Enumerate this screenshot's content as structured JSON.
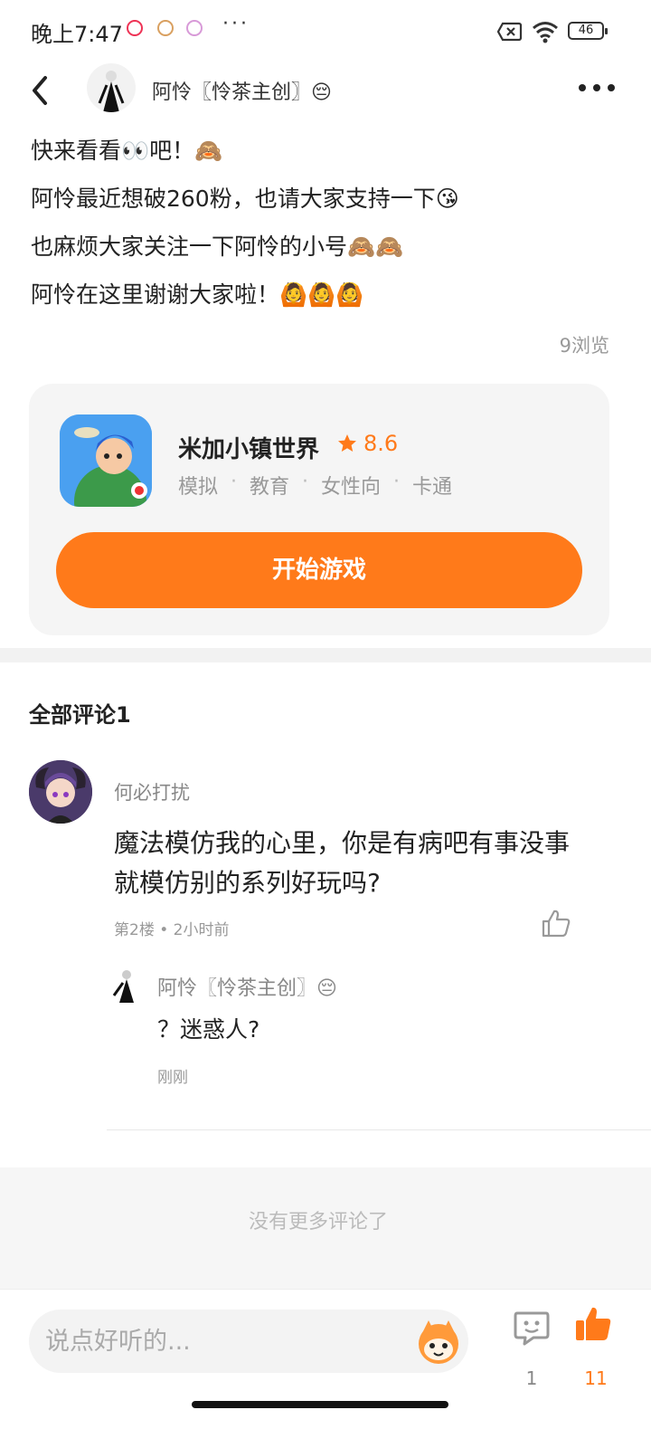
{
  "status": {
    "time": "晚上7:47",
    "more": "···",
    "battery": "46"
  },
  "header": {
    "author_name": "阿怜〖怜茶主创〗😔"
  },
  "post": {
    "lines": [
      "快来看看👀吧！🙈",
      "阿怜最近想破260粉，也请大家支持一下😘",
      "也麻烦大家关注一下阿怜的小号🙈🙈",
      "阿怜在这里谢谢大家啦！🙆🙆🙆"
    ],
    "views": "9浏览"
  },
  "game": {
    "title": "米加小镇世界",
    "rating": "8.6",
    "tags": [
      "模拟",
      "教育",
      "女性向",
      "卡通"
    ],
    "tag_separator": "·",
    "play_label": "开始游戏"
  },
  "comments": {
    "title": "全部评论1",
    "items": [
      {
        "user": "何必打扰",
        "text": "魔法模仿我的心里，你是有病吧有事没事就模仿别的系列好玩吗?",
        "meta": "第2楼 • 2小时前",
        "reply": {
          "user": "阿怜〖怜茶主创〗😔",
          "text": "？迷惑人?",
          "time": "刚刚"
        }
      }
    ],
    "no_more": "没有更多评论了"
  },
  "bottom_bar": {
    "input_placeholder": "说点好听的...",
    "comment_count": "1",
    "like_count": "11",
    "accent_color": "#ff7a1a"
  }
}
